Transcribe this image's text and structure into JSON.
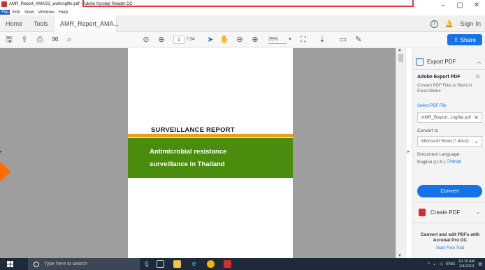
{
  "window": {
    "title": "AMR_Report_AMASS_workingfile.pdf - Adobe Acrobat Reader DC",
    "controls": [
      "–",
      "▢",
      "✕"
    ]
  },
  "menu": [
    "File",
    "Edit",
    "View",
    "Window",
    "Help"
  ],
  "tabs": {
    "home": "Home",
    "tools": "Tools",
    "doc": "AMR_Report_AMA...",
    "close": "×",
    "help": "?",
    "signin": "Sign In"
  },
  "toolbar": {
    "page_current": "1",
    "page_total": "/ 34",
    "zoom": "39%",
    "share": "Share"
  },
  "document": {
    "report_title": "SURVEILLANCE REPORT",
    "subtitle_line1": "Antimicrobial resistance",
    "subtitle_line2": "surveillance in Thailand",
    "colors": {
      "orange": "#f39c12",
      "green": "#4a8c0c"
    }
  },
  "panel": {
    "export_label": "Export PDF",
    "section_title": "Adobe Export PDF",
    "description": "Convert PDF Files to Word or Excel Online",
    "select_link": "Select PDF File",
    "selected_file": "AMR_Report...ingfile.pdf",
    "convert_to_label": "Convert to",
    "convert_format": "Microsoft Word (*.docx)",
    "doc_language_label": "Document Language:",
    "doc_language": "English (U.S.)",
    "change_link": "Change",
    "convert_button": "Convert",
    "create_pdf": "Create PDF",
    "promo": "Convert and edit PDFs with Acrobat Pro DC",
    "trial": "Start Free Trial"
  },
  "taskbar": {
    "search_placeholder": "Type here to search",
    "lang": "ENG",
    "time": "10:19 AM",
    "date": "2/4/2019"
  }
}
